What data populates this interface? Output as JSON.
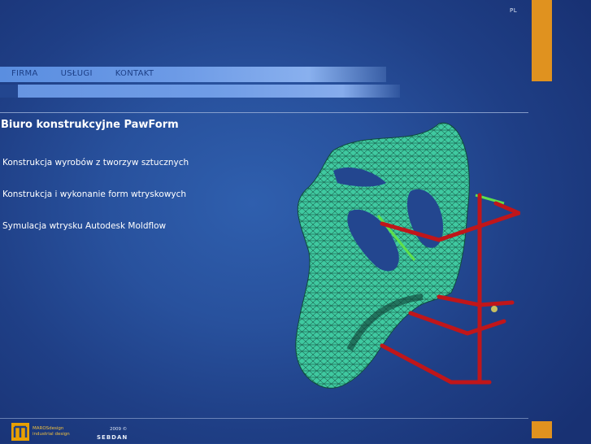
{
  "language": "PL",
  "nav": {
    "items": [
      {
        "label": "FIRMA"
      },
      {
        "label": "USŁUGI"
      },
      {
        "label": "KONTAKT"
      }
    ]
  },
  "main": {
    "title": "Biuro konstrukcyjne PawForm",
    "services": [
      "Konstrukcja wyrobów z tworzyw sztucznych",
      "Konstrukcja i wykonanie form wtryskowych",
      "Symulacja wtrysku Autodesk Moldflow"
    ]
  },
  "footer": {
    "logo_line1": "MAROSdesign",
    "logo_line2": "industrial design",
    "copyright": "2009 ©",
    "brand": "SEBDAN"
  },
  "colors": {
    "accent": "#e0921f",
    "mesh": "#3fc9a0",
    "rods": "#c0161a"
  }
}
